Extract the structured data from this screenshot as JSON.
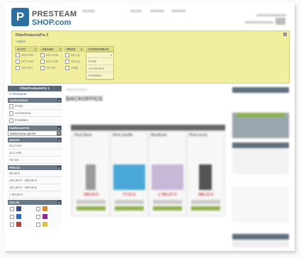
{
  "header": {
    "logo_letter": "P",
    "logo_line1": "PRESTEAM",
    "logo_line2": "SHOP.com"
  },
  "filter_box": {
    "title": "FilterProductsPro 2",
    "close": "x",
    "back": "Back",
    "columns": [
      {
        "header": "ALTO",
        "options": [
          "49,6 mm",
          "27,3 mm",
          "110 mm"
        ]
      },
      {
        "header": "ANCHO",
        "options": [
          "33,3 mm",
          "41,2 mm",
          "70 mm"
        ]
      },
      {
        "header": "PESO",
        "options": [
          "49,2 g",
          "15,5 g",
          "120g"
        ]
      }
    ],
    "categories": {
      "header": "CATEGORIAS",
      "options": [
        "iPods",
        "Accesorios",
        "Portátiles"
      ]
    }
  },
  "left_panel": {
    "title": "FilterProductsPro 1",
    "reset": "Restaurar",
    "sections": {
      "categorias": {
        "label": "CATEGORIAS",
        "items": [
          "iPods",
          "Accesorios",
          "Portátiles"
        ]
      },
      "fabricantes": {
        "label": "FABRICANTES",
        "select": "Selecciona opción"
      },
      "ancho": {
        "label": "ANCHO",
        "items": [
          "52,3 mm",
          "41,2 mm",
          "70 mm"
        ]
      },
      "precio": {
        "label": "PRECIO",
        "items": [
          "50,00 €",
          "100,00 € - 300,00 €",
          "201,00 € - 300,00 €",
          "> 90,00 €"
        ]
      },
      "color": {
        "label": "COLOR"
      }
    },
    "swatches": [
      "#3a4a8a",
      "#d88a2a",
      "#2a6ac8",
      "#8a2a8a",
      "#c83a3a",
      "#d8c84a"
    ]
  },
  "center": {
    "breadcrumb": "PRESTASHOP",
    "title": "BACKOFFICE",
    "products": [
      {
        "name": "iPod Nano",
        "price": "180,53 €"
      },
      {
        "name": "iPod shuffle",
        "price": "77,51 €"
      },
      {
        "name": "MacBook",
        "price": "1 381,27 €"
      },
      {
        "name": "iPod touch",
        "price": "285,13 €"
      }
    ]
  },
  "colors": {
    "filter_bg": "#f1ef9e",
    "panel_header": "#5a6a7a",
    "link": "#2c6fa0",
    "price": "#cc3333"
  }
}
